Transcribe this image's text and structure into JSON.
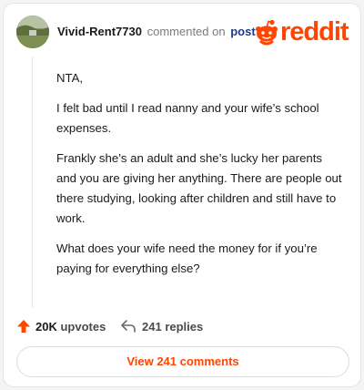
{
  "header": {
    "username": "Vivid-Rent7730",
    "action_text": "commented on",
    "post_link": "post",
    "brand": "reddit",
    "brand_color": "#ff4500"
  },
  "comment": {
    "paragraphs": [
      "NTA,",
      "I felt bad until I read nanny and your wife’s school expenses.",
      "Frankly she’s an adult and she’s lucky her parents and you are giving her anything. There are people out there studying, looking after children and still have to work.",
      "What does your wife need the money for if you’re paying for everything else?"
    ]
  },
  "actions": {
    "upvote_count": "20K",
    "upvote_label": "upvotes",
    "replies_count": "241",
    "replies_label": "replies",
    "upvote_icon": "upvote-arrow-icon",
    "reply_icon": "reply-arrow-icon"
  },
  "footer": {
    "view_comments_label": "View 241 comments"
  }
}
